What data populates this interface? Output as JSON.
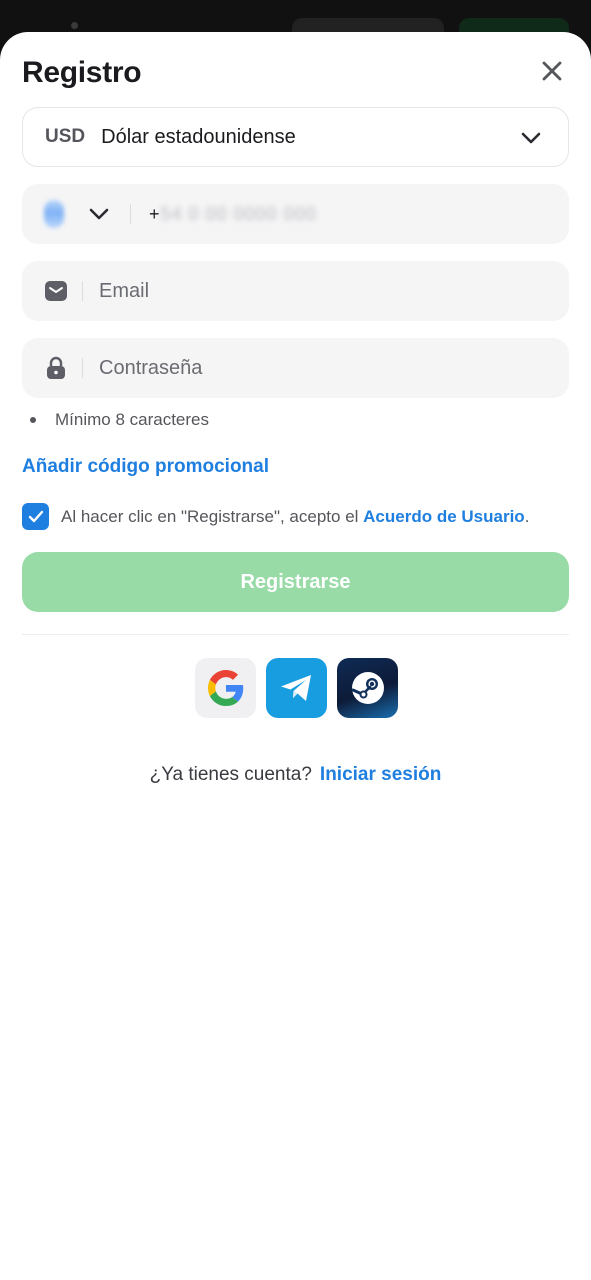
{
  "sheet": {
    "title": "Registro"
  },
  "currency": {
    "code": "USD",
    "name": "Dólar estadounidense"
  },
  "phone": {
    "prefix": "+",
    "value": "54 0 00 0000 000"
  },
  "email": {
    "placeholder": "Email"
  },
  "password": {
    "placeholder": "Contraseña",
    "hint": "Mínimo 8 caracteres"
  },
  "promo": {
    "label": "Añadir código promocional"
  },
  "agreement": {
    "checked": true,
    "text": "Al hacer clic en \"Registrarse\", acepto el ",
    "link": "Acuerdo de Usuario",
    "suffix": "."
  },
  "register": {
    "label": "Registrarse"
  },
  "social": {
    "icons": [
      "google-icon",
      "telegram-icon",
      "steam-icon"
    ]
  },
  "login": {
    "question": "¿Ya tienes cuenta?",
    "link": "Iniciar sesión"
  },
  "colors": {
    "accent": "#1f7fe0",
    "register_disabled": "#98dba7",
    "telegram": "#179de0",
    "steam": "#0e2b55"
  }
}
